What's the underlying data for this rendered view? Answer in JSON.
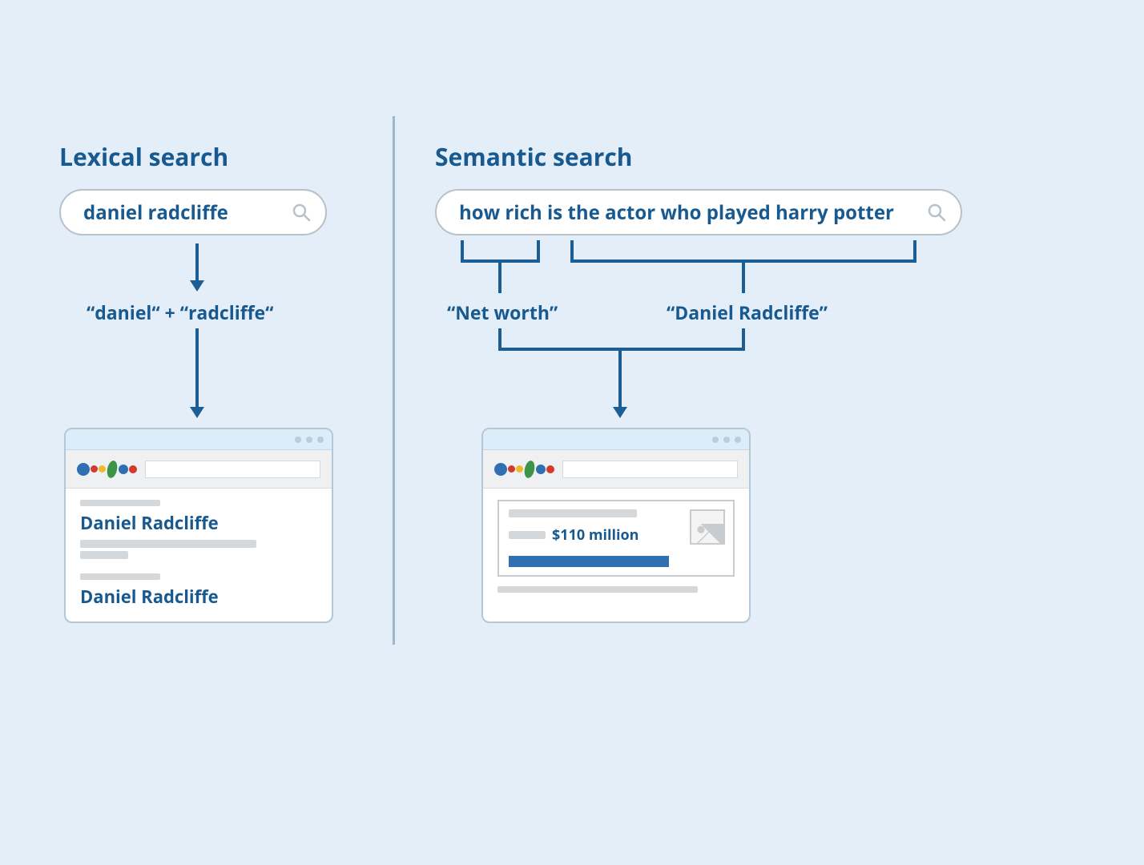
{
  "colors": {
    "bg": "#e3eef8",
    "ink": "#18598f",
    "line": "#1c5d94",
    "grey": "#d5d8da",
    "blue": "#2f6fb2"
  },
  "lexical": {
    "heading": "Lexical search",
    "query": "daniel radcliffe",
    "tokens_label": "“daniel“ + “radcliffe“",
    "result_title_1": "Daniel Radcliffe",
    "result_title_2": "Daniel Radcliffe"
  },
  "semantic": {
    "heading": "Semantic search",
    "query": "how rich is the actor who played harry potter",
    "concept_1": "“Net worth”",
    "concept_2": "“Daniel Radcliffe”",
    "answer_amount": "$110 million"
  }
}
